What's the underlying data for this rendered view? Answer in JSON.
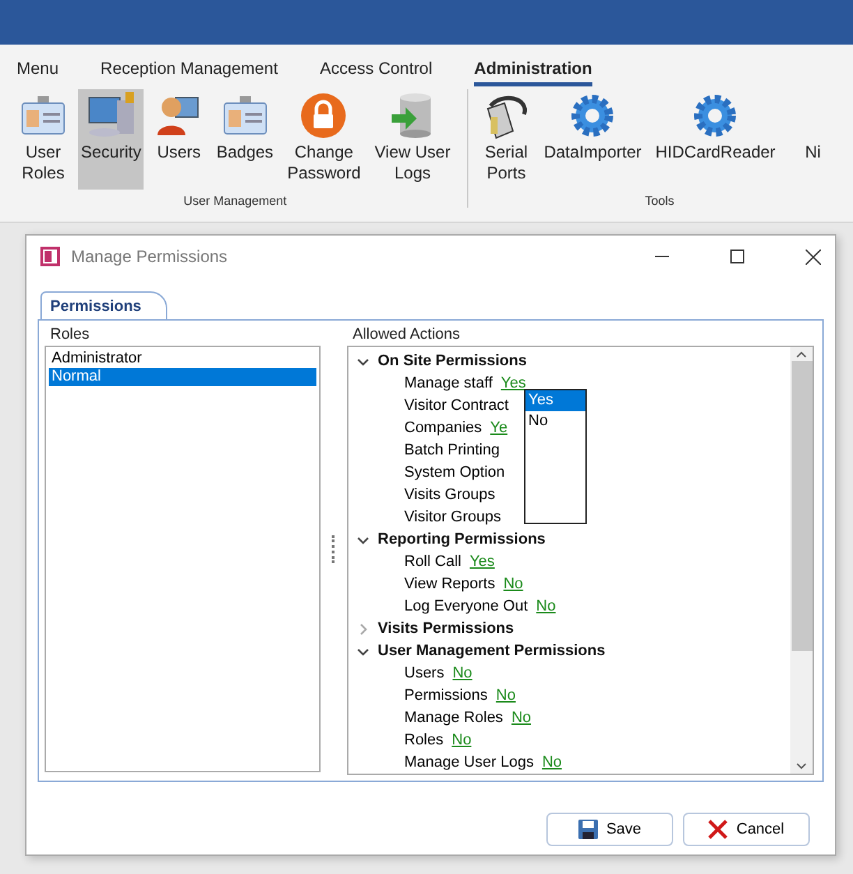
{
  "ribbon_tabs": [
    {
      "label": "Menu",
      "selected": false
    },
    {
      "label": "Reception Management",
      "selected": false
    },
    {
      "label": "Access Control",
      "selected": false
    },
    {
      "label": "Administration",
      "selected": true
    }
  ],
  "ribbon_groups": [
    {
      "label": "User Management",
      "items": [
        {
          "label": "User Roles",
          "kind": "badge",
          "selected": false
        },
        {
          "label": "Security",
          "kind": "computer",
          "selected": true
        },
        {
          "label": "Users",
          "kind": "person",
          "selected": false
        },
        {
          "label": "Badges",
          "kind": "badge",
          "selected": false
        },
        {
          "label": "Change Password",
          "kind": "lock",
          "selected": false
        },
        {
          "label": "View User Logs",
          "kind": "database",
          "selected": false
        }
      ]
    },
    {
      "label": "Tools",
      "items": [
        {
          "label": "Serial Ports",
          "kind": "plug",
          "selected": false
        },
        {
          "label": "DataImporter",
          "kind": "gear",
          "selected": false
        },
        {
          "label": "HIDCardReader",
          "kind": "gear",
          "selected": false
        },
        {
          "label": "Ni",
          "kind": "cut",
          "selected": false
        }
      ]
    }
  ],
  "dialog": {
    "title": "Manage Permissions",
    "tab": {
      "label": "Permissions",
      "selected": true
    },
    "roles": {
      "label": "Roles",
      "items": [
        {
          "label": "Administrator",
          "selected": false
        },
        {
          "label": "Normal",
          "selected": true
        }
      ]
    },
    "actions": {
      "label": "Allowed Actions",
      "groups": [
        {
          "label": "On Site Permissions",
          "expanded": true,
          "children": [
            {
              "label": "Manage staff",
              "value": "Yes"
            },
            {
              "label": "Visitor Contract"
            },
            {
              "label": "Companies",
              "value": "Ye"
            },
            {
              "label": "Batch Printing"
            },
            {
              "label": "System Option"
            },
            {
              "label": "Visits Groups"
            },
            {
              "label": "Visitor Groups"
            }
          ]
        },
        {
          "label": "Reporting Permissions",
          "expanded": true,
          "children": [
            {
              "label": "Roll Call",
              "value": "Yes"
            },
            {
              "label": "View Reports",
              "value": "No"
            },
            {
              "label": "Log Everyone Out",
              "value": "No"
            }
          ]
        },
        {
          "label": "Visits Permissions",
          "expanded": false
        },
        {
          "label": "User Management Permissions",
          "expanded": true,
          "children": [
            {
              "label": "Users",
              "value": "No"
            },
            {
              "label": "Permissions",
              "value": "No"
            },
            {
              "label": "Manage Roles",
              "value": "No"
            },
            {
              "label": "Roles",
              "value": "No"
            },
            {
              "label": "Manage User Logs",
              "value": "No"
            }
          ]
        }
      ],
      "dropdown": {
        "options": [
          {
            "label": "Yes",
            "selected": true
          },
          {
            "label": "No",
            "selected": false
          }
        ]
      }
    },
    "buttons": [
      {
        "label": "Save",
        "kind": "save"
      },
      {
        "label": "Cancel",
        "kind": "cancel"
      }
    ]
  }
}
